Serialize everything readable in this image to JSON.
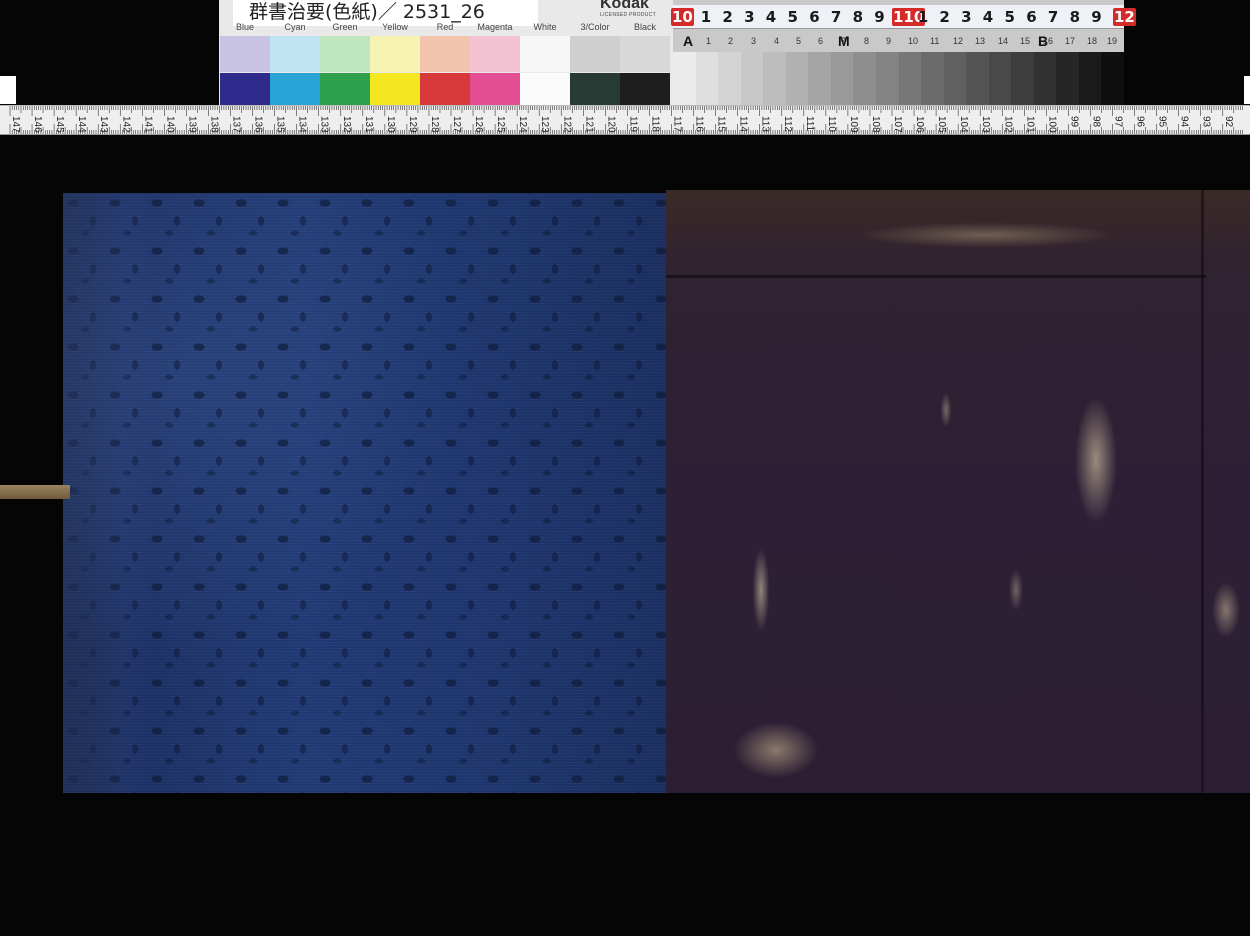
{
  "color_card": {
    "title": "群書治要(色紙)／ 2531_26",
    "brand": "Kodak",
    "brand_sub": "LICENSED PRODUCT",
    "patch_labels": [
      "Blue",
      "Cyan",
      "Green",
      "Yellow",
      "Red",
      "Magenta",
      "White",
      "3/Color",
      "Black"
    ],
    "top_row_colors": [
      "#c9c3e3",
      "#bfe3f2",
      "#bfe6bd",
      "#f6f3b2",
      "#f3c4ad",
      "#f3c2d3",
      "#f7f7f7",
      "#cfcfcf",
      "#d8d8d8"
    ],
    "bottom_row_colors": [
      "#2e2b8c",
      "#2aa3d6",
      "#2e9f4b",
      "#f4e61f",
      "#d83a3c",
      "#e24d93",
      "#fafafa",
      "#273a34",
      "#1e1e1e"
    ]
  },
  "gray_scale": {
    "ruler_numbers": [
      "10",
      "1",
      "2",
      "3",
      "4",
      "5",
      "6",
      "7",
      "8",
      "9",
      "110",
      "1",
      "2",
      "3",
      "4",
      "5",
      "6",
      "7",
      "8",
      "9",
      "12"
    ],
    "letters": [
      "A",
      "M",
      "B"
    ],
    "step_numbers": [
      "1",
      "2",
      "3",
      "4",
      "5",
      "6",
      "7",
      "8",
      "9",
      "10",
      "11",
      "12",
      "13",
      "14",
      "15",
      "16",
      "17",
      "18",
      "19"
    ]
  },
  "tape_measure": {
    "numbers": [
      "147",
      "146",
      "145",
      "144",
      "143",
      "142",
      "141",
      "140",
      "139",
      "138",
      "137",
      "136",
      "135",
      "134",
      "133",
      "132",
      "131",
      "130",
      "129",
      "128",
      "127",
      "126",
      "125",
      "124",
      "123",
      "122",
      "121",
      "120",
      "119",
      "118",
      "117",
      "116",
      "115",
      "114",
      "113",
      "112",
      "111",
      "110",
      "109",
      "108",
      "107",
      "106",
      "105",
      "104",
      "103",
      "102",
      "101",
      "100",
      "99",
      "98",
      "97",
      "96",
      "95",
      "94",
      "93",
      "92"
    ]
  },
  "scene": {
    "left_panel": "blue-damask-silk-cover",
    "right_panel": "dark-purple-worn-paper-cover",
    "accent_colors": {
      "silk": "#213a74",
      "paper": "#2d2036",
      "background": "#050505"
    }
  }
}
